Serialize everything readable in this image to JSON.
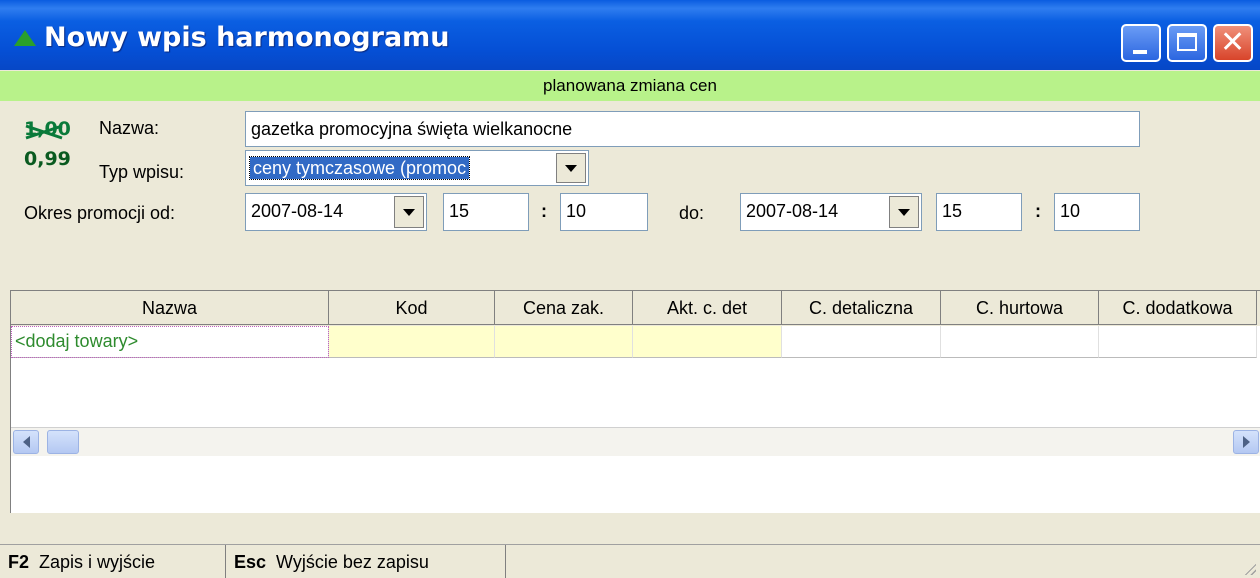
{
  "window": {
    "title": "Nowy wpis harmonogramu",
    "mode_banner": "planowana zmiana cen"
  },
  "logo": {
    "old_price": "1,00",
    "new_price": "0,99"
  },
  "form": {
    "name_label": "Nazwa:",
    "name_value": "gazetka promocyjna święta wielkanocne",
    "type_label": "Typ wpisu:",
    "type_value": "ceny tymczasowe (promoc",
    "period_from_label": "Okres promocji od:",
    "from_date": "2007-08-14",
    "from_hour": "15",
    "from_minute": "10",
    "time_separator": ":",
    "period_to_label": "do:",
    "to_date": "2007-08-14",
    "to_hour": "15",
    "to_minute": "10"
  },
  "grid": {
    "columns": [
      "Nazwa",
      "Kod",
      "Cena zak.",
      "Akt. c. det",
      "C. detaliczna",
      "C. hurtowa",
      "C. dodatkowa"
    ],
    "rows": [
      [
        "<dodaj towary>",
        "",
        "",
        "",
        "",
        "",
        ""
      ]
    ]
  },
  "statusbar": {
    "items": [
      {
        "key": "F2",
        "label": "Zapis i wyjście"
      },
      {
        "key": "Esc",
        "label": "Wyjście bez zapisu"
      }
    ]
  },
  "colors": {
    "title_bar": "#0550d6",
    "mode_banner": "#b8f28a",
    "selection": "#316ac5",
    "add_row_text": "#2e8b2e",
    "highlight_cells": "#ffffcc"
  }
}
